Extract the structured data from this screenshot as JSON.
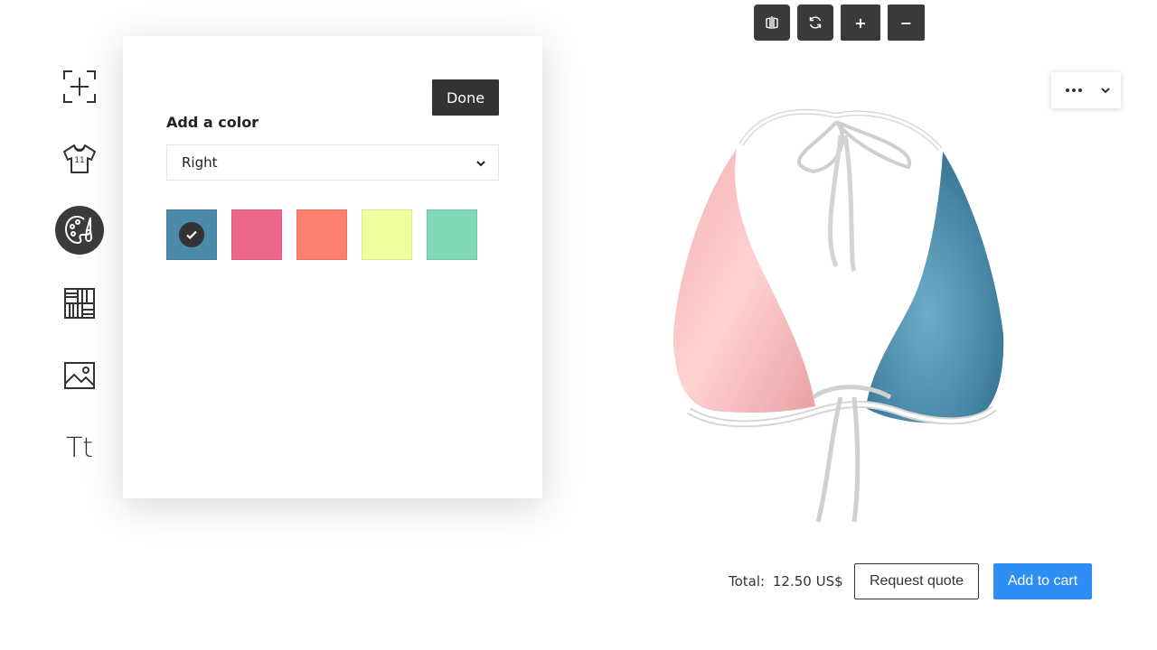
{
  "sidebar": {
    "items": [
      {
        "icon": "add-frame-icon"
      },
      {
        "icon": "jersey-icon"
      },
      {
        "icon": "palette-icon",
        "active": true
      },
      {
        "icon": "pattern-grid-icon"
      },
      {
        "icon": "image-icon"
      },
      {
        "icon": "text-icon",
        "label": "Tt"
      }
    ]
  },
  "panel": {
    "title": "Add a color",
    "done_label": "Done",
    "select_value": "Right",
    "swatches": [
      {
        "color": "#4a8aa8",
        "selected": true
      },
      {
        "color": "#ec6688",
        "selected": false
      },
      {
        "color": "#fd8070",
        "selected": false
      },
      {
        "color": "#eeff9e",
        "selected": false
      },
      {
        "color": "#7fd9b6",
        "selected": false
      }
    ]
  },
  "toolbar": {
    "buttons": [
      {
        "icon": "mirror-icon"
      },
      {
        "icon": "rotate-icon"
      },
      {
        "label": "+",
        "icon": "zoom-in-icon"
      },
      {
        "label": "−",
        "icon": "zoom-out-icon"
      }
    ]
  },
  "more_menu": {
    "icon": "more-dots-icon"
  },
  "product": {
    "left_color": "#f9c4c4",
    "right_color": "#4a8aa8"
  },
  "footer": {
    "total_label": "Total:",
    "total_value": "12.50 US$",
    "quote_label": "Request quote",
    "cart_label": "Add to cart"
  }
}
